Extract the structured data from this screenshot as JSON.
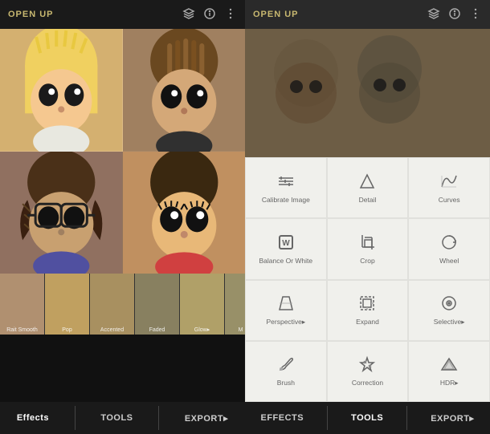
{
  "app": {
    "title": "OPEN UP"
  },
  "left": {
    "header": {
      "title": "OPEN UP",
      "icons": [
        "layers",
        "info",
        "more"
      ]
    },
    "bottom_toolbar": {
      "effects_label": "Effects",
      "tools_label": "TOOLS",
      "export_label": "EXPORT▸"
    },
    "thumbnails": [
      {
        "label": "Rait Smooth",
        "bg": "#c8a878"
      },
      {
        "label": "Pop",
        "bg": "#b09060"
      },
      {
        "label": "Accented",
        "bg": "#c0b080"
      },
      {
        "label": "Faded",
        "bg": "#909070"
      },
      {
        "label": "Glow▸",
        "bg": "#b8a068"
      },
      {
        "label": "M",
        "bg": "#a09060"
      }
    ]
  },
  "right": {
    "header": {
      "title": "OPEN UP",
      "icons": [
        "layers",
        "info",
        "more"
      ]
    },
    "tools": [
      {
        "id": "calibrate",
        "label": "Calibrate Image",
        "icon": "calibrate"
      },
      {
        "id": "detail",
        "label": "Detail",
        "icon": "detail"
      },
      {
        "id": "curves",
        "label": "Curves",
        "icon": "curves"
      },
      {
        "id": "balance",
        "label": "Balance Or White",
        "icon": "balance"
      },
      {
        "id": "crop",
        "label": "Crop",
        "icon": "crop"
      },
      {
        "id": "wheel",
        "label": "Wheel",
        "icon": "wheel"
      },
      {
        "id": "perspective",
        "label": "Perspective▸",
        "icon": "perspective"
      },
      {
        "id": "expand",
        "label": "Expand",
        "icon": "expand"
      },
      {
        "id": "selective",
        "label": "Selective▸",
        "icon": "selective"
      },
      {
        "id": "brush",
        "label": "Brush",
        "icon": "brush"
      },
      {
        "id": "correction",
        "label": "Correction",
        "icon": "correction"
      },
      {
        "id": "hdr",
        "label": "HDR▸",
        "icon": "hdr"
      }
    ],
    "bottom_toolbar": {
      "effects_label": "EFFECTS",
      "tools_label": "TOOLS",
      "export_label": "EXPORT▸"
    }
  }
}
